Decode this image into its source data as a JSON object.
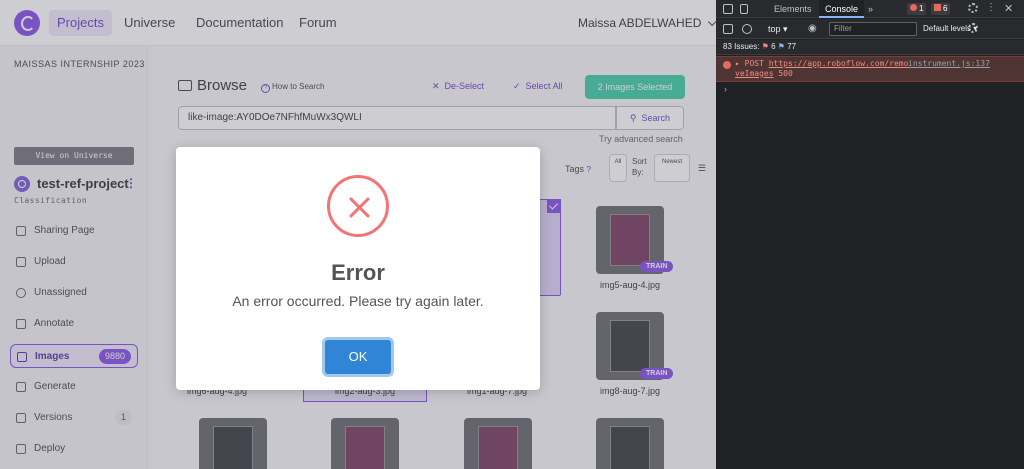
{
  "nav": {
    "projects": "Projects",
    "universe": "Universe",
    "documentation": "Documentation",
    "forum": "Forum",
    "user": "Maissa ABDELWAHED"
  },
  "sidebar": {
    "workspace": "MAISSAS INTERNSHIP 2023",
    "view_universe": "View on Universe",
    "project_name": "test-ref-project",
    "project_type": "Classification",
    "items": [
      {
        "label": "Sharing Page",
        "icon": "share-icon"
      },
      {
        "label": "Upload",
        "icon": "upload-icon"
      },
      {
        "label": "Unassigned",
        "icon": "search-icon"
      },
      {
        "label": "Annotate",
        "icon": "annotate-icon"
      },
      {
        "label": "Images",
        "icon": "images-icon",
        "badge": "9880"
      },
      {
        "label": "Generate",
        "icon": "generate-icon"
      },
      {
        "label": "Versions",
        "icon": "versions-icon",
        "badge": "1"
      },
      {
        "label": "Deploy",
        "icon": "deploy-icon"
      }
    ]
  },
  "browse": {
    "title": "Browse",
    "how_to": "How to Search",
    "deselect": "De-Select",
    "select_all": "Select All",
    "selected": "2 Images Selected",
    "query": "like-image:AY0DOe7NFhfMuWx3QWLI",
    "search": "Search",
    "advanced": "Try advanced search",
    "tags": "Tags",
    "all": "All",
    "sort_by": "Sort By:",
    "newest": "Newest",
    "train": "TRAIN",
    "images": [
      {
        "caption": "img5-aug-4.jpg"
      },
      {
        "caption": "img8-aug-7.jpg"
      },
      {
        "caption": "img6-aug-4.jpg"
      },
      {
        "caption": "img2-aug-3.jpg"
      },
      {
        "caption": "img1-aug-7.jpg"
      }
    ]
  },
  "dialog": {
    "title": "Error",
    "message": "An error occurred. Please try again later.",
    "ok": "OK"
  },
  "devtools": {
    "tab_elements": "Elements",
    "tab_console": "Console",
    "error_count": "1",
    "warn_count": "6",
    "context": "top",
    "filter_placeholder": "Filter",
    "levels": "Default levels",
    "issues_label": "83 Issues:",
    "issues_warn": "6",
    "issues_info": "77",
    "log_method": "POST",
    "log_url_1": "https://app.roboflow.com/remo",
    "log_url_2": "veImages",
    "log_status": "500",
    "log_source": "instrument.js:137",
    "prompt": "›"
  },
  "colors": {
    "accent": "#7b3fe4",
    "teal": "#2cc8a0",
    "error": "#f27474",
    "ok_button": "#3085d6"
  }
}
